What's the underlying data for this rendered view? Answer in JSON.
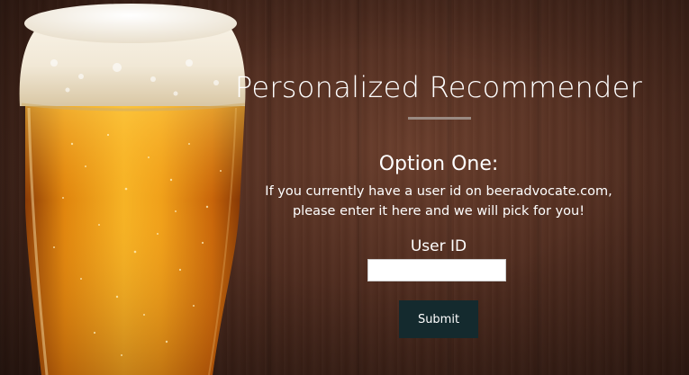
{
  "page": {
    "title": "Personalized Recommender",
    "option": {
      "heading": "Option One:",
      "description_line1": "If you currently have a user id on beeradvocate.com,",
      "description_line2": "please enter it here and we will pick for you!"
    },
    "form": {
      "user_id_label": "User ID",
      "user_id_value": "",
      "user_id_placeholder": "",
      "submit_label": "Submit"
    }
  },
  "images": {
    "hero": "beer-glass-image"
  },
  "colors": {
    "background_wood": "#4e2b1e",
    "text": "#ffffff",
    "divider": "#9a8a82",
    "button_bg": "#142a2e"
  }
}
